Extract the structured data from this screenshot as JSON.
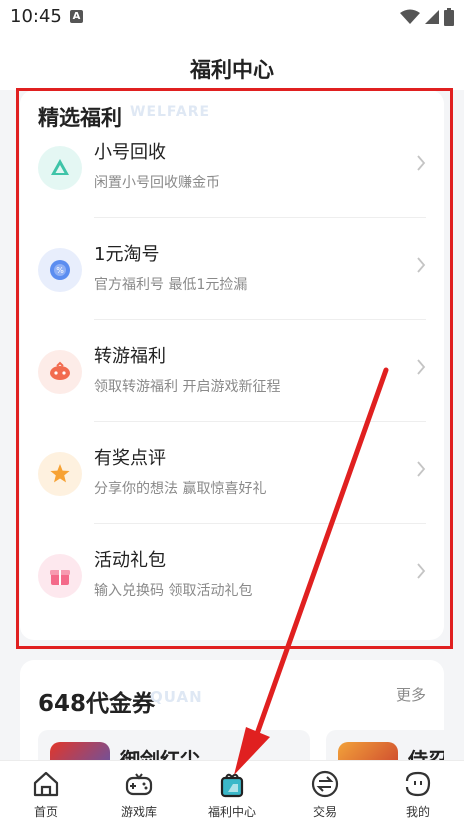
{
  "status_bar": {
    "time": "10:45",
    "notification_badge": "A"
  },
  "header": {
    "title": "福利中心"
  },
  "featured": {
    "title": "精选福利",
    "items": [
      {
        "label": "小号回收",
        "subtitle": "闲置小号回收赚金币",
        "icon": "recycle-triangle-icon",
        "color": "#3fc4a8"
      },
      {
        "label": "1元淘号",
        "subtitle": "官方福利号 最低1元捡漏",
        "icon": "coupon-badge-icon",
        "color": "#5b8df0"
      },
      {
        "label": "转游福利",
        "subtitle": "领取转游福利 开启游戏新征程",
        "icon": "game-pad-icon",
        "color": "#f26b4f"
      },
      {
        "label": "有奖点评",
        "subtitle": "分享你的想法 赢取惊喜好礼",
        "icon": "star-comment-icon",
        "color": "#f7a234"
      },
      {
        "label": "活动礼包",
        "subtitle": "输入兑换码 领取活动礼包",
        "icon": "gift-box-icon",
        "color": "#f46a8a"
      }
    ]
  },
  "vouchers": {
    "title": "648代金券",
    "more": "更多",
    "games": [
      {
        "name": "御剑红尘"
      },
      {
        "name": "侍忍"
      }
    ]
  },
  "tabs": [
    {
      "label": "首页",
      "icon": "home-icon"
    },
    {
      "label": "游戏库",
      "icon": "gamepad-icon"
    },
    {
      "label": "福利中心",
      "icon": "gift-bag-icon"
    },
    {
      "label": "交易",
      "icon": "exchange-icon"
    },
    {
      "label": "我的",
      "icon": "profile-icon"
    }
  ],
  "colors": {
    "highlight_outline": "#e02020",
    "active_tab": "#3bb8c9"
  }
}
